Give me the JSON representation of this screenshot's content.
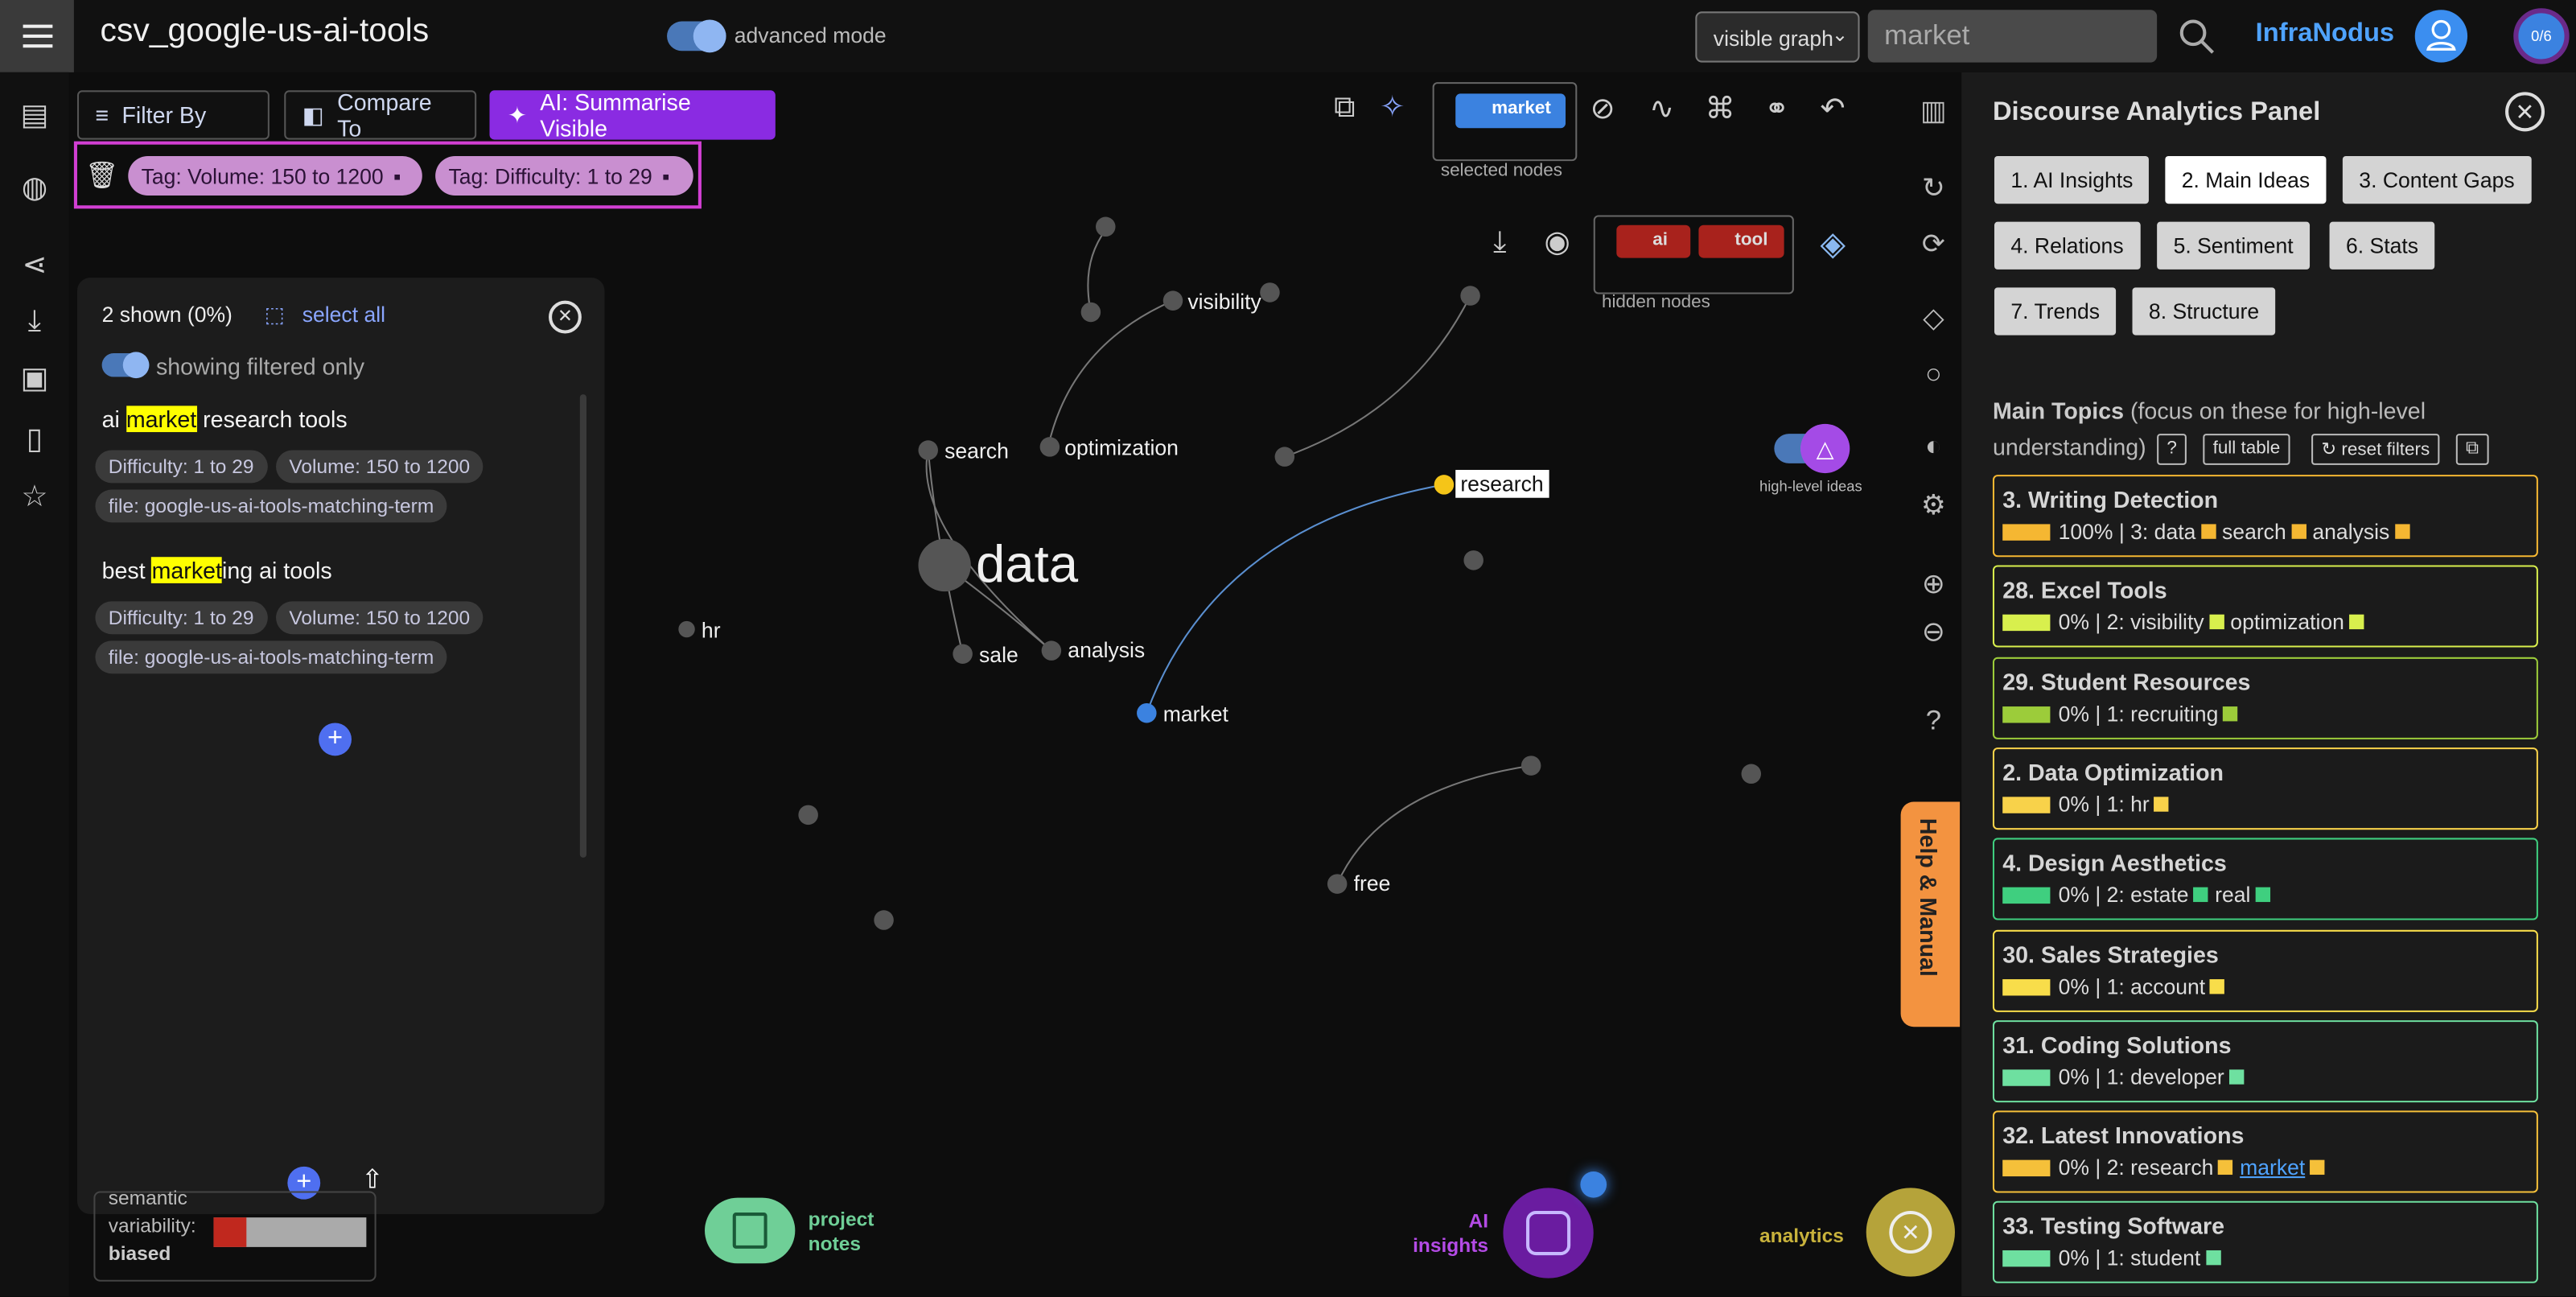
{
  "header": {
    "title": "csv_google-us-ai-tools",
    "advanced_mode": "advanced mode",
    "graph_view": "visible graph",
    "search_value": "market",
    "brand": "InfraNodus",
    "counter": "0/6"
  },
  "toolbar": {
    "filter_by": "Filter By",
    "compare_to": "Compare To",
    "ai_summarise": "AI: Summarise Visible"
  },
  "filters": {
    "tags": [
      "Tag: Volume: 150 to 1200",
      "Tag: Difficulty: 1 to 29"
    ]
  },
  "results": {
    "count": "2 shown (0%)",
    "select_all": "select all",
    "filter_toggle": "showing filtered only",
    "items": [
      {
        "pre": "ai ",
        "highlight": "market",
        "post": " research tools",
        "chips": [
          "Difficulty: 1 to 29",
          "Volume: 150 to 1200",
          "file: google-us-ai-tools-matching-term"
        ]
      },
      {
        "pre": "best ",
        "highlight": "market",
        "post": "ing ai tools",
        "chips": [
          "Difficulty: 1 to 29",
          "Volume: 150 to 1200",
          "file: google-us-ai-tools-matching-term"
        ]
      }
    ]
  },
  "graph": {
    "selected_nodes_label": "selected nodes",
    "selected_node": "market",
    "hidden_nodes_label": "hidden nodes",
    "hidden_nodes": [
      "ai",
      "tool"
    ],
    "high_level_label": "high-level ideas",
    "nodes": [
      "visibility",
      "search",
      "optimization",
      "research",
      "data",
      "hr",
      "sale",
      "analysis",
      "market",
      "free"
    ]
  },
  "semantic": {
    "line1": "semantic",
    "line2": "variability:",
    "line3": "biased"
  },
  "panel": {
    "title": "Discourse Analytics Panel",
    "tabs": [
      "1. AI Insights",
      "2. Main Ideas",
      "3. Content Gaps",
      "4. Relations",
      "5. Sentiment",
      "6. Stats",
      "7. Trends",
      "8. Structure"
    ],
    "main_topics_title": "Main Topics",
    "main_topics_note": "(focus on these for high-level understanding)",
    "help": "?",
    "full_table": "full table",
    "reset_filters": "↻ reset filters",
    "topics": [
      {
        "name": "3. Writing Detection",
        "stats": "100% | 3: data",
        "words": [
          "search",
          "analysis"
        ],
        "color": "#f5b732"
      },
      {
        "name": "28. Excel Tools",
        "stats": "0% | 2: visibility",
        "words": [
          "optimization"
        ],
        "color": "#d8ef4d"
      },
      {
        "name": "29. Student Resources",
        "stats": "0% | 1: recruiting",
        "words": [],
        "color": "#9ccc3a"
      },
      {
        "name": "2. Data Optimization",
        "stats": "0% | 1: hr",
        "words": [],
        "color": "#f8d24a"
      },
      {
        "name": "4. Design Aesthetics",
        "stats": "0% | 2: estate",
        "words": [
          "real"
        ],
        "color": "#3fcf7f"
      },
      {
        "name": "30. Sales Strategies",
        "stats": "0% | 1: account",
        "words": [],
        "color": "#f8dd4a"
      },
      {
        "name": "31. Coding Solutions",
        "stats": "0% | 1: developer",
        "words": [],
        "color": "#6ee0a0"
      },
      {
        "name": "32. Latest Innovations",
        "stats": "0% | 2: research",
        "words": [
          "market"
        ],
        "color": "#f5c03a"
      },
      {
        "name": "33. Testing Software",
        "stats": "0% | 1: student",
        "words": [],
        "color": "#6ee0a0"
      }
    ]
  },
  "help_tab": "Help & Manual",
  "bottom": {
    "project_notes": "project notes",
    "ai_insights": "AI insights",
    "analytics": "analytics"
  }
}
